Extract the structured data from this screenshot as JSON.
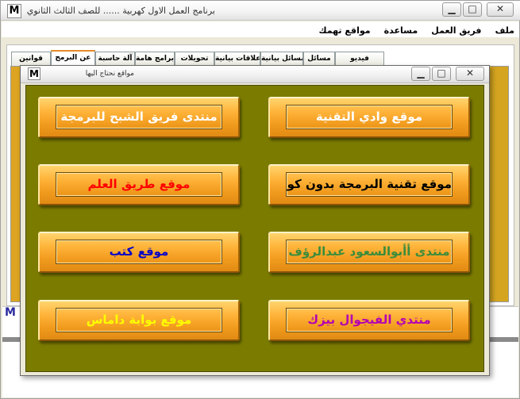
{
  "main_window": {
    "icon_letter": "M",
    "title": "برنامج العمل الاول كهربية ...... للصف الثالث الثانوي",
    "controls": {
      "minimize": "▁",
      "maximize": "□",
      "close": "✕"
    },
    "menu": [
      "ملف",
      "فريق العمل",
      "مساعدة",
      "مواقع تهمك"
    ],
    "tabs": [
      "فيديو",
      "مسائل",
      "مسائل بيانية",
      "علاقات بيانية",
      "تحويلات",
      "برامج هامة",
      "آلة حاسبة",
      "عن البرمج",
      "قوانين"
    ],
    "active_tab": "عن البرمج",
    "side_mark": "M"
  },
  "dialog": {
    "icon_letter": "M",
    "title": "مواقع نحتاج اليها",
    "controls": {
      "minimize": "▁",
      "maximize": "□",
      "close": "✕"
    },
    "buttons": [
      {
        "label": "موقع وادي التقنية",
        "color": "#ffffff"
      },
      {
        "label": "منتدى فريق الشبح للبرمجة",
        "color": "#ffffff"
      },
      {
        "label": "موقع تقنية البرمجة بدون كود",
        "color": "#000000"
      },
      {
        "label": "موقع طريق العلم",
        "color": "#ff0000"
      },
      {
        "label": "منتدى أأبوالسعود عبدالرؤف",
        "color": "#3c8c3c"
      },
      {
        "label": "موقع  كتب",
        "color": "#0000c8"
      },
      {
        "label": "منتدي الفيجوال بيزك",
        "color": "#b400b4"
      },
      {
        "label": "موقع بوابة داماس",
        "color": "#ffff00"
      }
    ]
  }
}
